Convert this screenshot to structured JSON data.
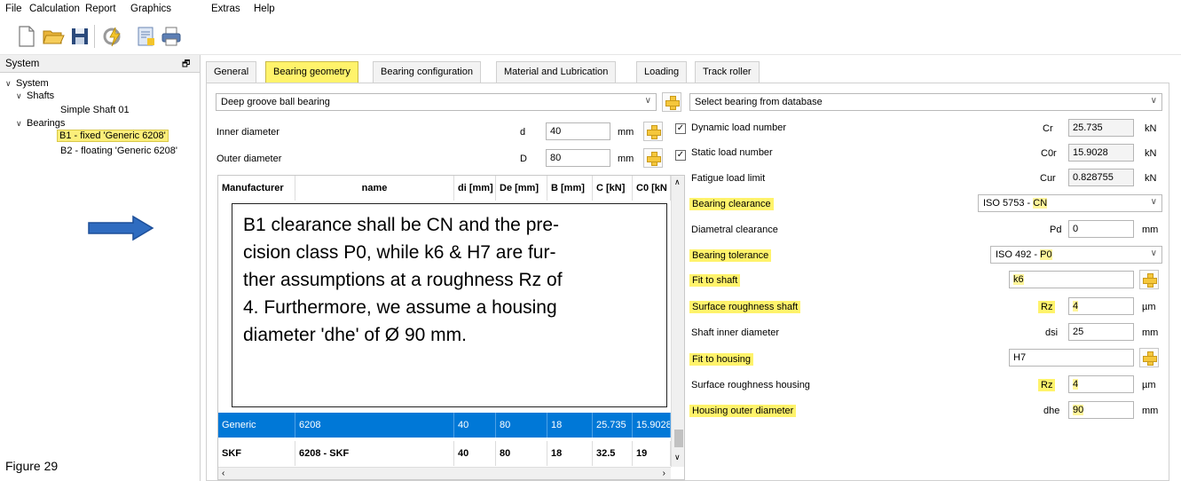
{
  "menu": [
    "File",
    "Calculation",
    "Report",
    "Graphics",
    "Extras",
    "Help"
  ],
  "toolbar_icons": [
    "new-file-icon",
    "open-folder-icon",
    "save-icon",
    "calculate-icon",
    "report-icon",
    "print-icon"
  ],
  "system_panel": {
    "title": "System",
    "pin": "🗗",
    "tree": {
      "root": "System",
      "shafts_label": "Shafts",
      "shaft_item": "Simple Shaft 01",
      "bearings_label": "Bearings",
      "bearing_1": "B1 - fixed 'Generic 6208'",
      "bearing_2": "B2 - floating 'Generic 6208'"
    }
  },
  "figure_caption": "Figure 29",
  "tabs": [
    "General",
    "Bearing geometry",
    "Bearing configuration",
    "Material and Lubrication",
    "Loading",
    "Track roller"
  ],
  "active_tab": "Bearing geometry",
  "left_form": {
    "bearing_type": "Deep groove ball bearing",
    "inner_diameter": {
      "label": "Inner diameter",
      "symbol": "d",
      "value": "40",
      "unit": "mm"
    },
    "outer_diameter": {
      "label": "Outer diameter",
      "symbol": "D",
      "value": "80",
      "unit": "mm"
    }
  },
  "table": {
    "headers": [
      "Manufacturer",
      "name",
      "di [mm]",
      "De [mm]",
      "B [mm]",
      "C [kN]",
      "C0 [kN"
    ],
    "rows": [
      {
        "manufacturer": "Generic",
        "name": "6208",
        "di": "40",
        "de": "80",
        "b": "18",
        "c": "25.735",
        "c0": "15.9028",
        "selected": true
      },
      {
        "manufacturer": "SKF",
        "name": "6208 - SKF",
        "di": "40",
        "de": "80",
        "b": "18",
        "c": "32.5",
        "c0": "19",
        "selected": false
      }
    ]
  },
  "note": {
    "lines": [
      "B1 clearance shall be CN and the pre-",
      "cision class P0, while k6 & H7 are fur-",
      "ther assumptions at a roughness Rz of",
      "4. Furthermore, we assume a housing",
      "diameter 'dhe' of Ø 90 mm."
    ]
  },
  "right_form": {
    "database_select": "Select bearing from database",
    "dynamic_load": {
      "label": "Dynamic load number",
      "symbol": "Cr",
      "value": "25.735",
      "unit": "kN"
    },
    "static_load": {
      "label": "Static load number",
      "symbol": "C0r",
      "value": "15.9028",
      "unit": "kN"
    },
    "fatigue_limit": {
      "label": "Fatigue load limit",
      "symbol": "Cur",
      "value": "0.828755",
      "unit": "kN"
    },
    "bearing_clearance": {
      "label": "Bearing clearance",
      "value_prefix": "ISO 5753 - ",
      "value_hl": "CN"
    },
    "diametral_clearance": {
      "label": "Diametral clearance",
      "symbol": "Pd",
      "value": "0",
      "unit": "mm"
    },
    "bearing_tolerance": {
      "label": "Bearing tolerance",
      "value_prefix": "ISO 492 - ",
      "value_hl": "P0"
    },
    "fit_shaft": {
      "label": "Fit to shaft",
      "value": "k6"
    },
    "roughness_shaft": {
      "label": "Surface roughness shaft",
      "symbol": "Rz",
      "value": "4",
      "unit": "µm"
    },
    "shaft_inner": {
      "label": "Shaft inner diameter",
      "symbol": "dsi",
      "value": "25",
      "unit": "mm"
    },
    "fit_housing": {
      "label": "Fit to housing",
      "value": "H7"
    },
    "roughness_housing": {
      "label": "Surface roughness housing",
      "symbol": "Rz",
      "value": "4",
      "unit": "µm"
    },
    "housing_outer": {
      "label": "Housing outer diameter",
      "symbol": "dhe",
      "value": "90",
      "unit": "mm"
    }
  }
}
